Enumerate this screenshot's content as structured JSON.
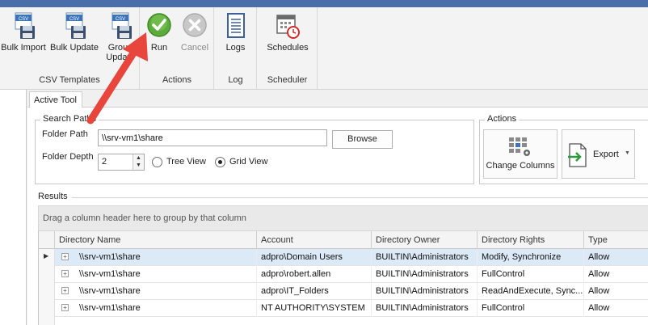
{
  "ribbon": {
    "csv_group": {
      "label": "CSV Templates",
      "bulk_import": "Bulk Import",
      "bulk_update": "Bulk Update",
      "group_update": "Group Update",
      "csv_badge": "CSV"
    },
    "actions_group": {
      "label": "Actions",
      "run": "Run",
      "cancel": "Cancel"
    },
    "log_group": {
      "label": "Log",
      "logs": "Logs"
    },
    "scheduler_group": {
      "label": "Scheduler",
      "schedules": "Schedules"
    }
  },
  "tabs": [
    {
      "label": "Active Tool"
    }
  ],
  "search_paths": {
    "legend": "Search Paths",
    "folder_path_label": "Folder Path",
    "folder_path_value": "\\\\srv-vm1\\share",
    "browse_label": "Browse",
    "folder_depth_label": "Folder Depth",
    "folder_depth_value": "2",
    "tree_view_label": "Tree View",
    "grid_view_label": "Grid View",
    "selected_view": "grid"
  },
  "actions_panel": {
    "legend": "Actions",
    "change_columns": "Change Columns",
    "export": "Export"
  },
  "results": {
    "legend": "Results",
    "group_panel_hint": "Drag a column header here to group by that column",
    "columns": [
      "Directory Name",
      "Account",
      "Directory Owner",
      "Directory Rights",
      "Type"
    ],
    "rows": [
      [
        "\\\\srv-vm1\\share",
        "adpro\\Domain Users",
        "BUILTIN\\Administrators",
        "Modify, Synchronize",
        "Allow"
      ],
      [
        "\\\\srv-vm1\\share",
        "adpro\\robert.allen",
        "BUILTIN\\Administrators",
        "FullControl",
        "Allow"
      ],
      [
        "\\\\srv-vm1\\share",
        "adpro\\IT_Folders",
        "BUILTIN\\Administrators",
        "ReadAndExecute, Sync...",
        "Allow"
      ],
      [
        "\\\\srv-vm1\\share",
        "NT AUTHORITY\\SYSTEM",
        "BUILTIN\\Administrators",
        "FullControl",
        "Allow"
      ]
    ]
  },
  "colors": {
    "title_bar": "#4a6ea9",
    "selected_row": "#dce9f7",
    "run_green": "#5cab3c",
    "arrow_red": "#e8453c"
  }
}
